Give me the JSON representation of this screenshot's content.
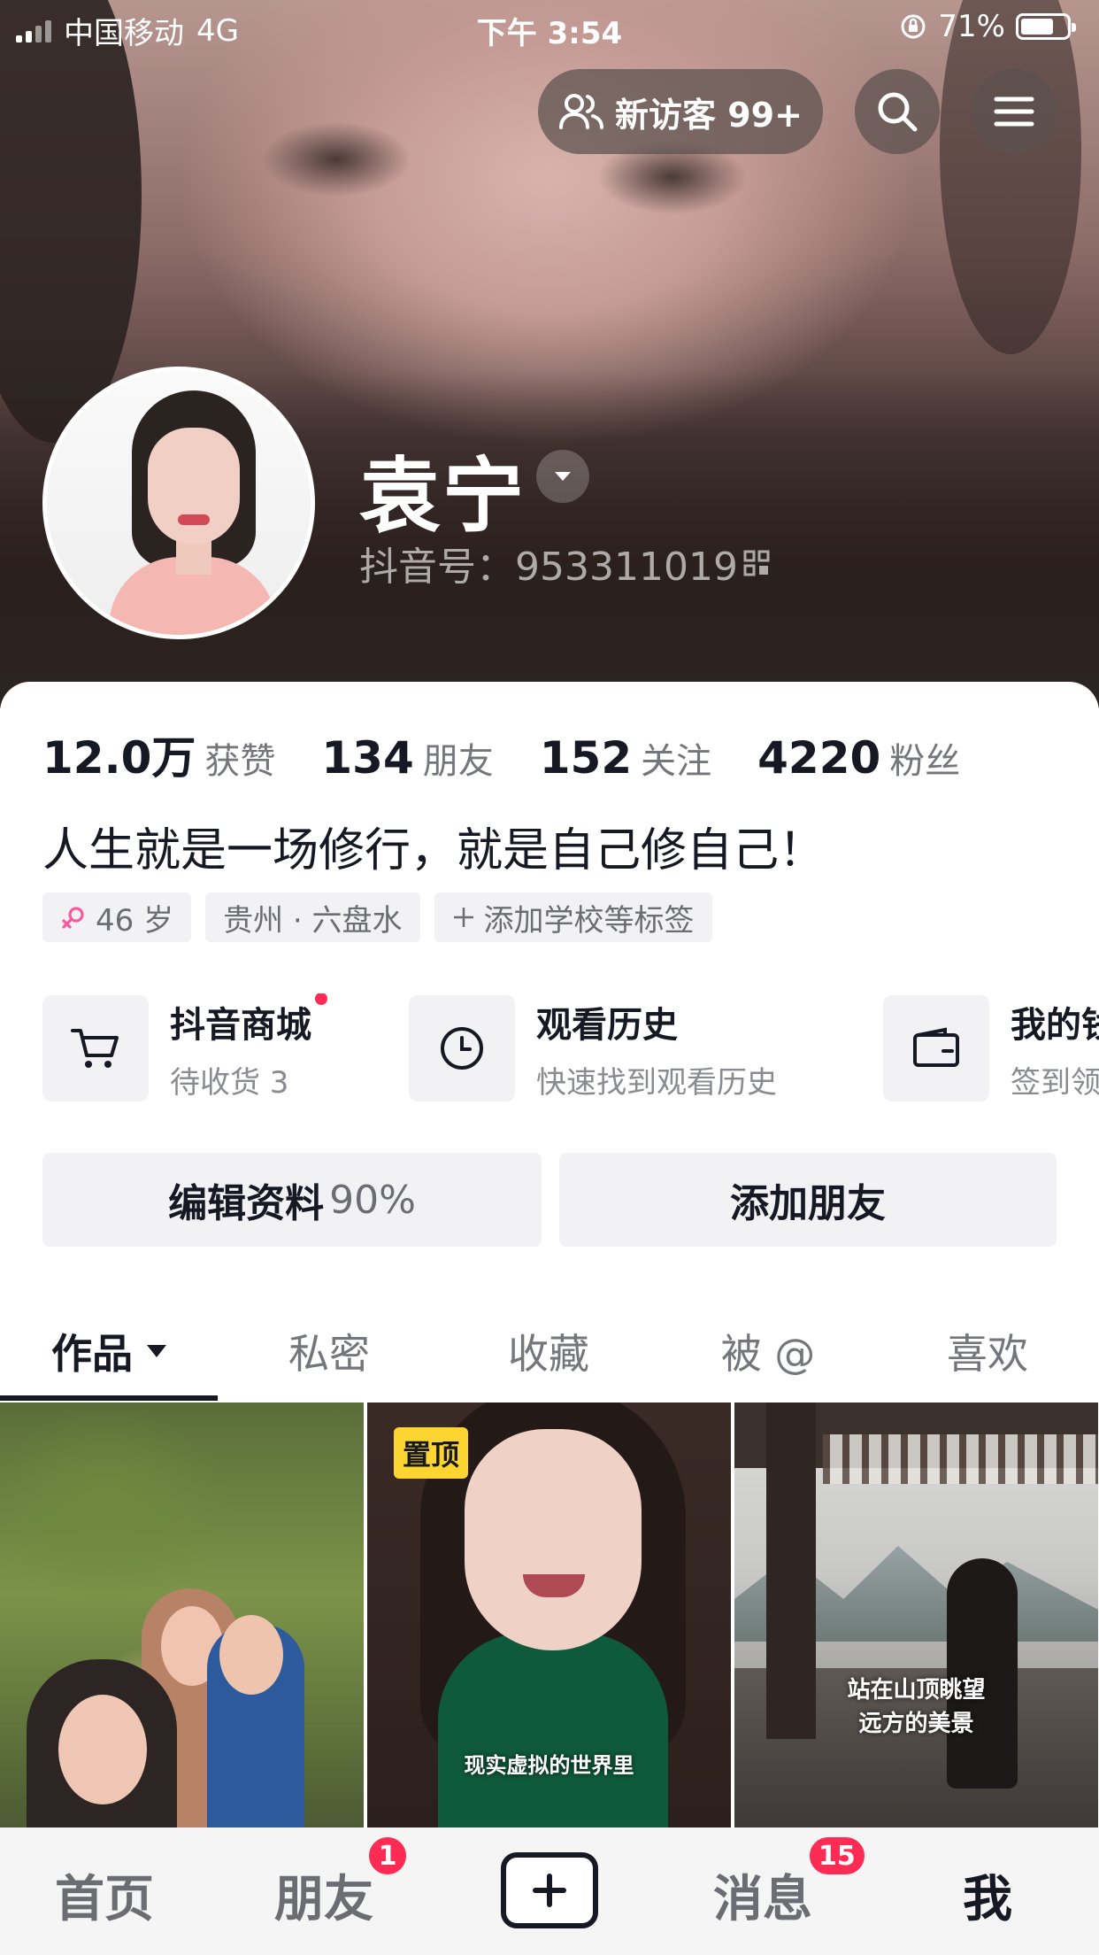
{
  "status_bar": {
    "carrier": "中国移动",
    "network": "4G",
    "time": "下午 3:54",
    "battery": "71%",
    "battery_level": 0.71
  },
  "header": {
    "visitors_label": "新访客 99+"
  },
  "profile": {
    "name": "袁宁",
    "douyin_id": "抖音号：953311019"
  },
  "stats": [
    {
      "value": "12.0万",
      "label": "获赞"
    },
    {
      "value": "134",
      "label": "朋友"
    },
    {
      "value": "152",
      "label": "关注"
    },
    {
      "value": "4220",
      "label": "粉丝"
    }
  ],
  "bio": "人生就是一场修行，就是自己修自己！",
  "tags": {
    "age": "46 岁",
    "location": "贵州 · 六盘水",
    "add": "添加学校等标签"
  },
  "shortcuts": [
    {
      "title": "抖音商城",
      "sub": "待收货 3",
      "icon": "cart-icon"
    },
    {
      "title": "观看历史",
      "sub": "快速找到观看历史",
      "icon": "clock-icon"
    },
    {
      "title": "我的钱包",
      "sub": "签到领",
      "icon": "wallet-icon"
    }
  ],
  "actions": {
    "edit": "编辑资料",
    "edit_pct": "90%",
    "add_friend": "添加朋友"
  },
  "tabs": [
    "作品",
    "私密",
    "收藏",
    "被 @",
    "喜欢"
  ],
  "videos": [
    {
      "caption": ""
    },
    {
      "pin": "置顶",
      "caption": "现实虚拟的世界里"
    },
    {
      "caption": "站在山顶眺望远方的美景"
    }
  ],
  "bottom_nav": {
    "home": "首页",
    "friends": "朋友",
    "friends_badge": "1",
    "messages": "消息",
    "messages_badge": "15",
    "me": "我"
  },
  "colors": {
    "accent": "#fe2c55",
    "pin": "#fcd531",
    "text_primary": "#161823"
  }
}
